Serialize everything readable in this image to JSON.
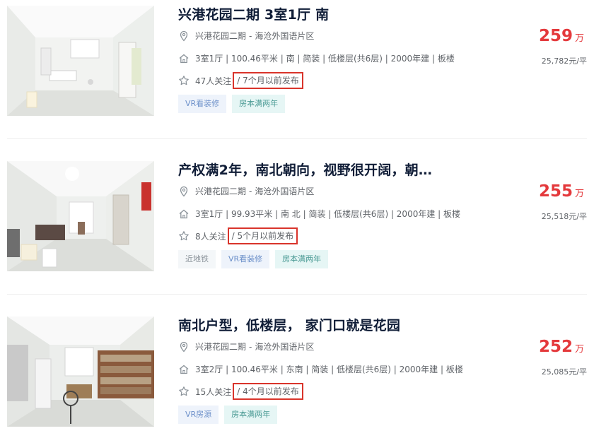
{
  "listings": [
    {
      "title": "兴港花园二期 3室1厅 南",
      "community": "兴港花园二期",
      "area": "海沧外国语片区",
      "info": "3室1厅 | 100.46平米 | 南 | 简装 | 低楼层(共6层) | 2000年建 | 板楼",
      "followers": "47人关注",
      "published": "/ 7个月以前发布",
      "tags": [
        "VR看装修",
        "房本满两年"
      ],
      "price": "259",
      "price_unit": "万",
      "unit_price": "25,782元/平"
    },
    {
      "title": "产权满2年，南北朝向，视野很开阔，朝…",
      "community": "兴港花园二期",
      "area": "海沧外国语片区",
      "info": "3室1厅 | 99.93平米 | 南 北 | 简装 | 低楼层(共6层) | 2000年建 | 板楼",
      "followers": "8人关注",
      "published": "/ 5个月以前发布",
      "tags": [
        "近地铁",
        "VR看装修",
        "房本满两年"
      ],
      "price": "255",
      "price_unit": "万",
      "unit_price": "25,518元/平"
    },
    {
      "title": "南北户型，低楼层， 家门口就是花园",
      "community": "兴港花园二期",
      "area": "海沧外国语片区",
      "info": "3室2厅 | 100.46平米 | 东南 | 简装 | 低楼层(共6层) | 2000年建 | 板楼",
      "followers": "15人关注",
      "published": "/ 4个月以前发布",
      "tags": [
        "VR房源",
        "房本满两年"
      ],
      "price": "252",
      "price_unit": "万",
      "unit_price": "25,085元/平"
    }
  ],
  "address_separator": "-",
  "colors": {
    "price": "#e4393c",
    "title": "#101d37",
    "highlight_box": "#d9342b"
  }
}
